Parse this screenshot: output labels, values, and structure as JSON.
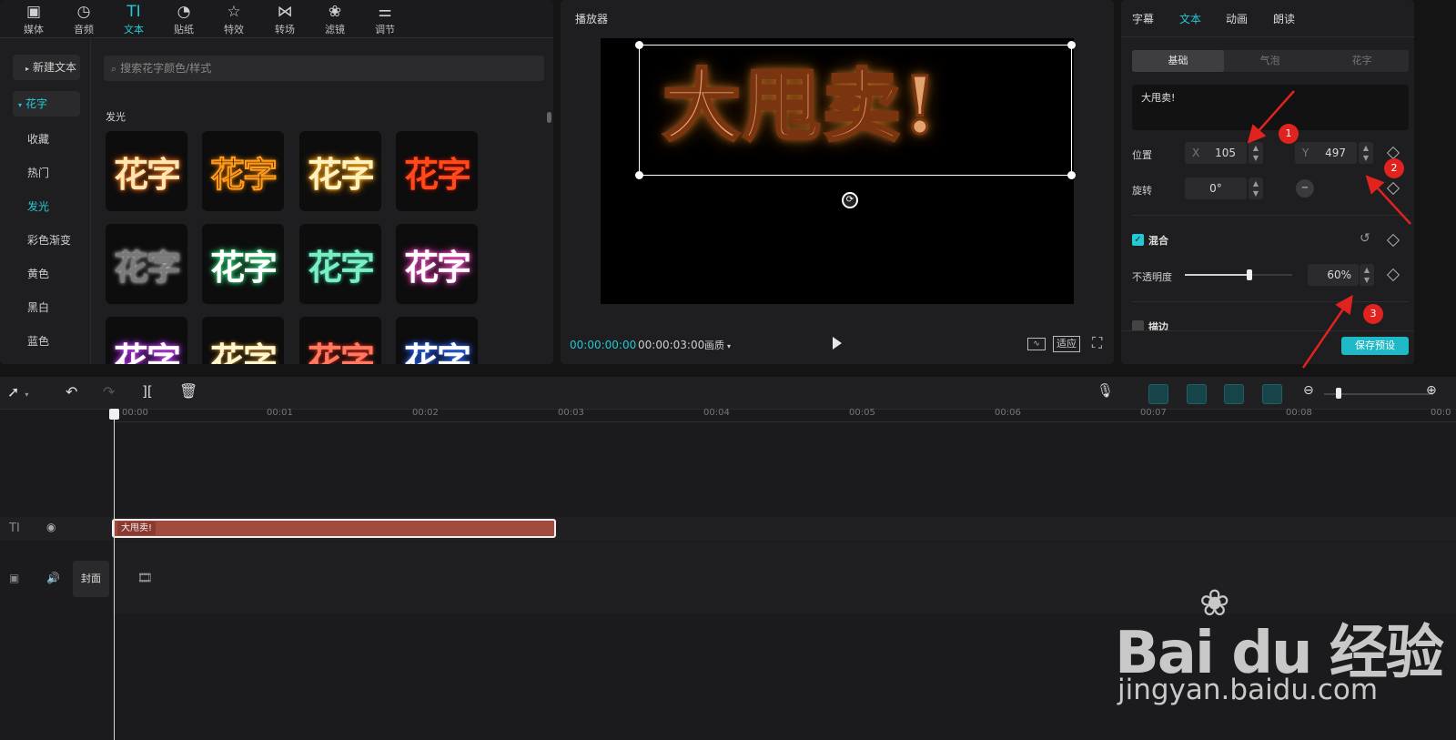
{
  "toolbar": {
    "tools": [
      {
        "icon": "media-icon",
        "glyph": "▣",
        "label": "媒体"
      },
      {
        "icon": "audio-icon",
        "glyph": "◷",
        "label": "音频"
      },
      {
        "icon": "text-icon",
        "glyph": "TI",
        "label": "文本"
      },
      {
        "icon": "sticker-icon",
        "glyph": "◔",
        "label": "贴纸"
      },
      {
        "icon": "effects-icon",
        "glyph": "☆",
        "label": "特效"
      },
      {
        "icon": "transition-icon",
        "glyph": "⋈",
        "label": "转场"
      },
      {
        "icon": "filter-icon",
        "glyph": "❀",
        "label": "滤镜"
      },
      {
        "icon": "adjust-icon",
        "glyph": "⚌",
        "label": "调节"
      }
    ]
  },
  "sidebar": {
    "new_text": "新建文本",
    "section": "花字",
    "items": [
      "收藏",
      "热门",
      "发光",
      "彩色渐变",
      "黄色",
      "黑白",
      "蓝色"
    ]
  },
  "library": {
    "search_placeholder": "搜索花字颜色/样式",
    "category_title": "发光",
    "thumb_text": "花字"
  },
  "player": {
    "title": "播放器",
    "preview_text": "大甩卖!",
    "current_time": "00:00:00:00",
    "total_time": "00:00:03:00",
    "quality_label": "画质",
    "fit_label": "适应"
  },
  "inspector": {
    "tabs": [
      "字幕",
      "文本",
      "动画",
      "朗读"
    ],
    "subtabs": [
      "基础",
      "气泡",
      "花字"
    ],
    "text_value": "大甩卖!",
    "position_label": "位置",
    "x_label": "X",
    "x_value": "105",
    "y_label": "Y",
    "y_value": "497",
    "rotation_label": "旋转",
    "rotation_value": "0°",
    "blend_label": "混合",
    "opacity_label": "不透明度",
    "opacity_value": "60%",
    "opacity_level": 0.6,
    "stroke_label": "描边",
    "save_preset": "保存预设",
    "markers": [
      "1",
      "2",
      "3"
    ]
  },
  "timeline": {
    "ruler": [
      "00:00",
      "00:01",
      "00:02",
      "00:03",
      "00:04",
      "00:05",
      "00:06",
      "00:07",
      "00:08",
      "00:0"
    ],
    "text_clip": "大甩卖!",
    "cover_label": "封面"
  },
  "watermark": {
    "brand": "Bai du 经验",
    "url": "jingyan.baidu.com"
  },
  "colors": {
    "accent": "#22c9d6",
    "clip": "#a34a3f",
    "marker": "#e0231f"
  }
}
